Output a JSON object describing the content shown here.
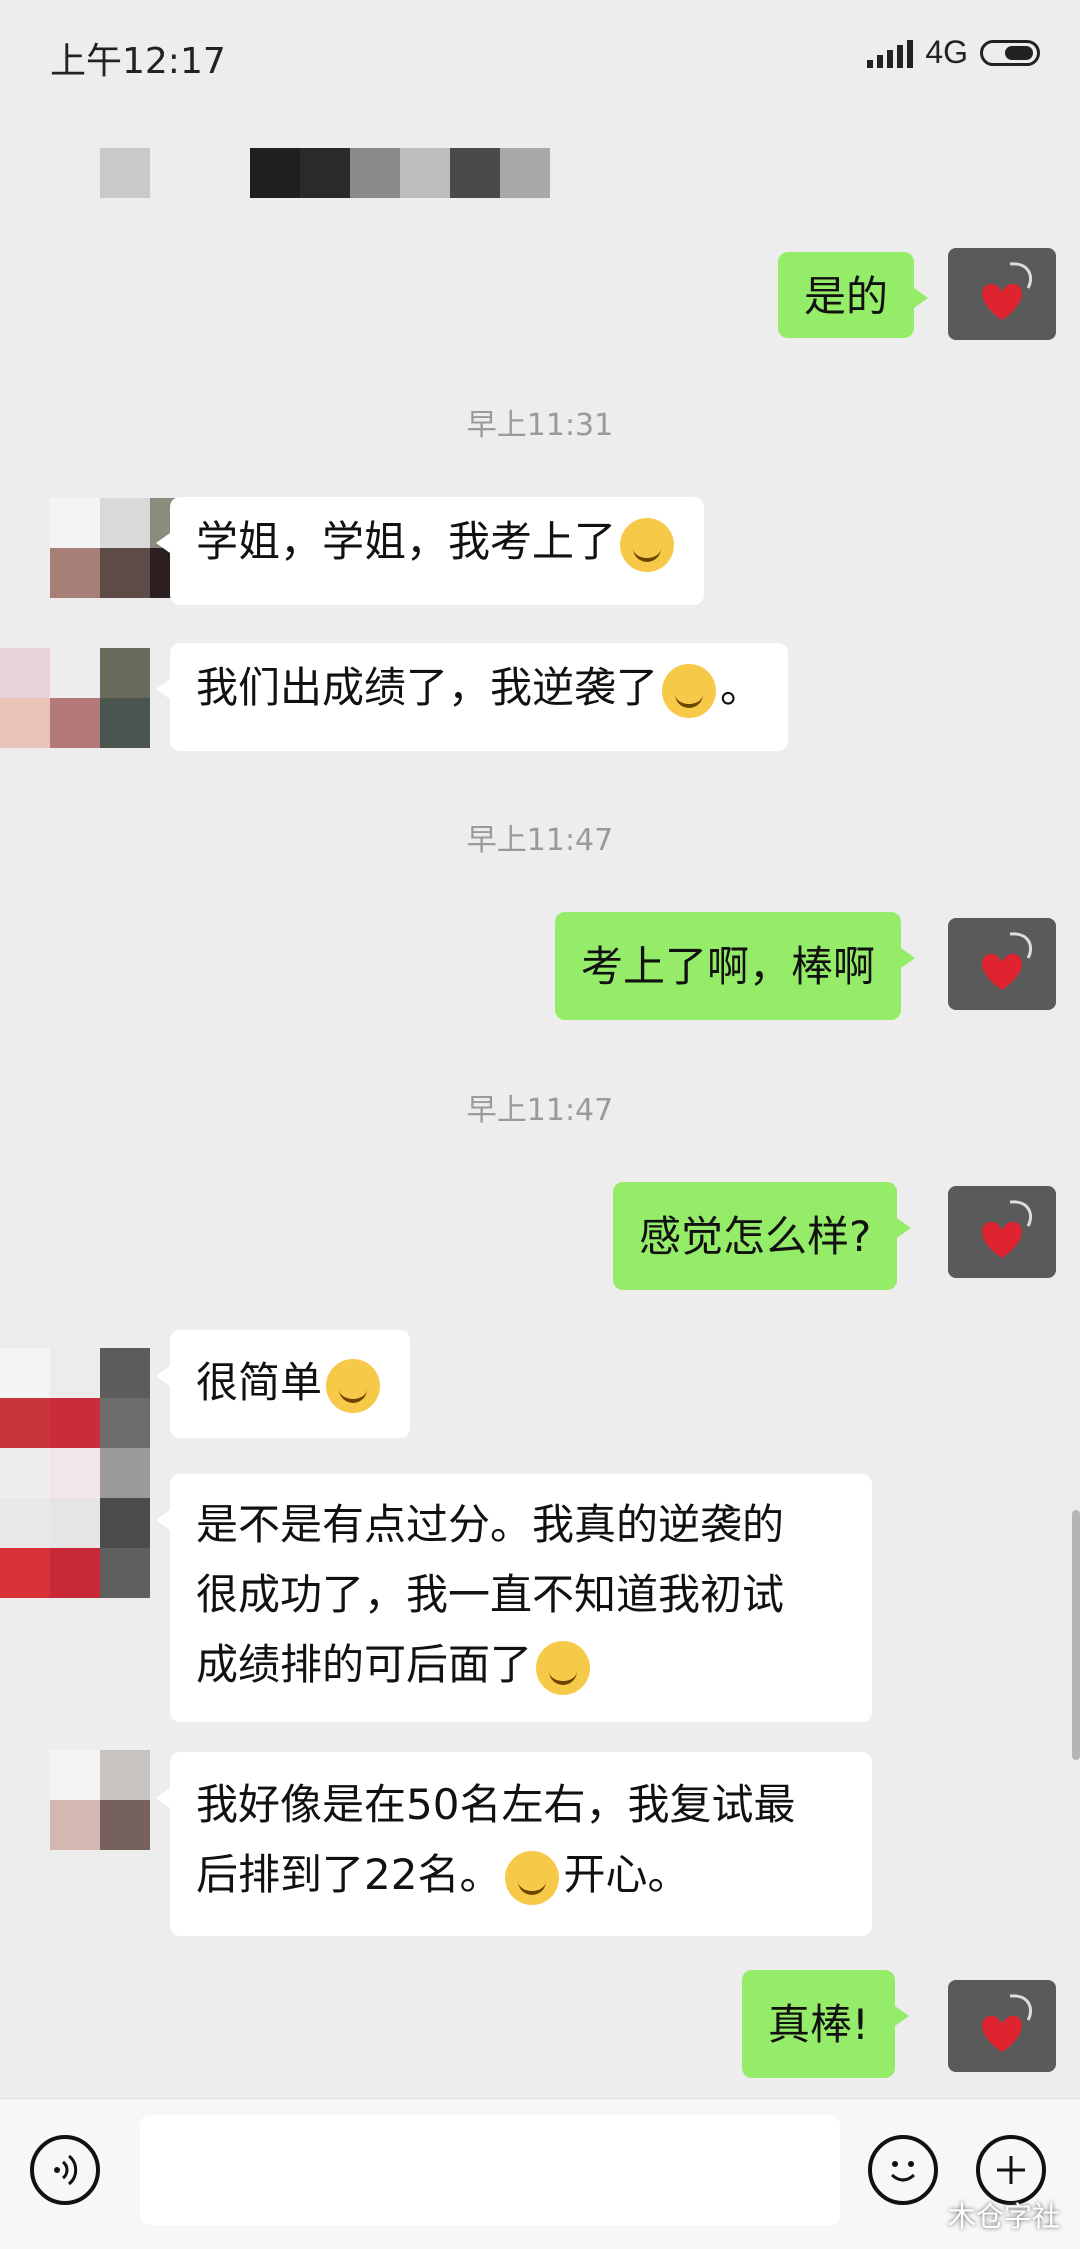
{
  "status_bar": {
    "time": "上午12:17",
    "network": "4G"
  },
  "messages": {
    "m1": "是的",
    "ts1": "早上11:31",
    "m2": "学姐，学姐，我考上了",
    "m3": "我们出成绩了，我逆袭了",
    "m3_end": "。",
    "ts2": "早上11:47",
    "m4": "考上了啊，棒啊",
    "ts3": "早上11:47",
    "m5": "感觉怎么样?",
    "m6": "很简单",
    "m7_l1": "是不是有点过分。我真的逆袭的",
    "m7_l2": "很成功了，我一直不知道我初试",
    "m7_l3": "成绩排的可后面了",
    "m8_l1": "我好像是在50名左右，我复试最",
    "m8_l2": "后排到了22名。",
    "m8_end": "开心。",
    "m9": "真棒!"
  },
  "watermark": "木仓字社",
  "icons": [
    "voice-icon",
    "emoji-icon",
    "plus-icon",
    "heart-stethoscope-icon"
  ]
}
